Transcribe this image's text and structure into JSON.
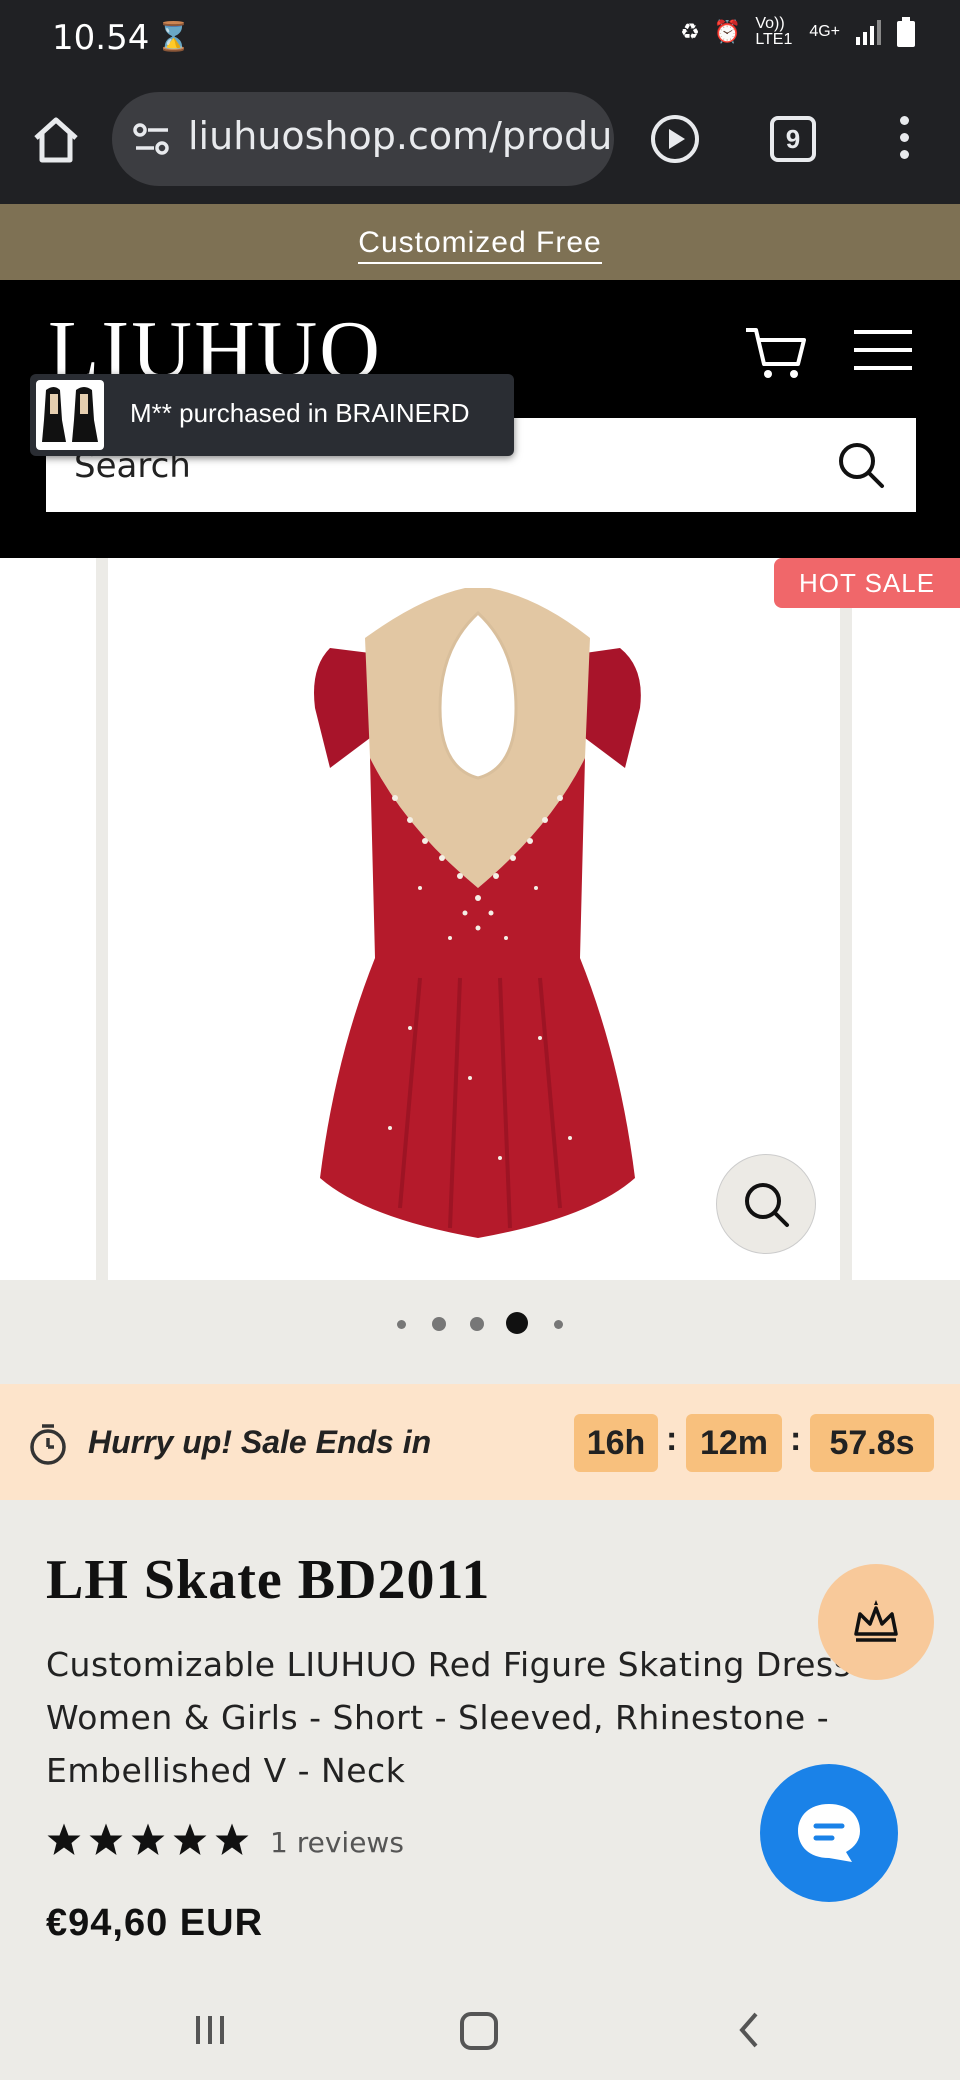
{
  "status_bar": {
    "time": "10.54",
    "network": "Vo)) LTE1",
    "signal_type": "4G+"
  },
  "browser": {
    "url": "liuhuoshop.com/produc",
    "tab_count": "9"
  },
  "announcement": {
    "text": "Customized Free"
  },
  "header": {
    "logo": "LIUHUO",
    "search_placeholder": "Search"
  },
  "toast": {
    "text": "M** purchased in BRAINERD"
  },
  "gallery": {
    "badge": "HOT SALE",
    "slide_count": 5,
    "active_slide": 4
  },
  "countdown": {
    "label": "Hurry up! Sale Ends in",
    "hours": "16h",
    "minutes": "12m",
    "seconds": "57.8s",
    "separator": ":"
  },
  "product": {
    "title": "LH Skate BD2011",
    "description": "Customizable LIUHUO Red Figure Skating Dress Women & Girls - Short - Sleeved, Rhinestone - Embellished V - Neck",
    "rating": 5,
    "reviews": "1 reviews",
    "price": "€94,60 EUR"
  },
  "colors": {
    "announcement_bg": "#7e7154",
    "badge": "#f0676a",
    "timer_box": "#f8c07d",
    "chat": "#1a82e8",
    "dress": "#b51a2b"
  }
}
